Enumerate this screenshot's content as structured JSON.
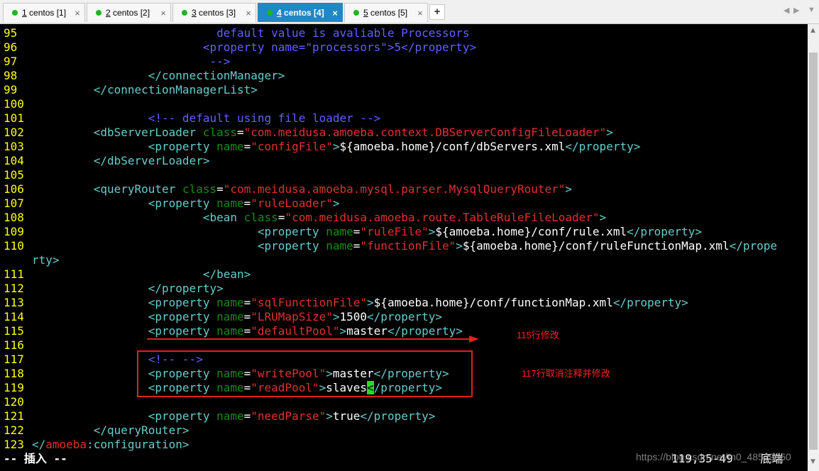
{
  "tabs": [
    {
      "num": "1",
      "label": " centos [1]",
      "active": false
    },
    {
      "num": "2",
      "label": " centos [2]",
      "active": false
    },
    {
      "num": "3",
      "label": " centos [3]",
      "active": false
    },
    {
      "num": "4",
      "label": " centos [4]",
      "active": true
    },
    {
      "num": "5",
      "label": " centos [5]",
      "active": false
    }
  ],
  "tab_close_glyph": "×",
  "tab_add_glyph": "+",
  "nav": {
    "prev": "◀",
    "next": "▶",
    "menu": "▼"
  },
  "editor": {
    "lines": [
      {
        "n": "95",
        "segs": [
          [
            "                           ",
            "white"
          ],
          [
            "default value is avaliable Processors",
            "blue"
          ]
        ]
      },
      {
        "n": "96",
        "segs": [
          [
            "                         ",
            "white"
          ],
          [
            "<property name=\"processors\">5</property>",
            "blue"
          ]
        ]
      },
      {
        "n": "97",
        "segs": [
          [
            "                          ",
            "white"
          ],
          [
            "-->",
            "blue"
          ]
        ]
      },
      {
        "n": "98",
        "segs": [
          [
            "                 ",
            "white"
          ],
          [
            "</connectionManager>",
            "tag"
          ]
        ]
      },
      {
        "n": "99",
        "segs": [
          [
            "         ",
            "white"
          ],
          [
            "</connectionManagerList>",
            "tag"
          ]
        ]
      },
      {
        "n": "100",
        "segs": []
      },
      {
        "n": "101",
        "segs": [
          [
            "                 ",
            "white"
          ],
          [
            "<!-- default using file loader -->",
            "blue"
          ]
        ]
      },
      {
        "n": "102",
        "segs": [
          [
            "         ",
            "white"
          ],
          [
            "<dbServerLoader ",
            "tag"
          ],
          [
            "class",
            "attr"
          ],
          [
            "=",
            "white"
          ],
          [
            "\"com.meidusa.amoeba.context.DBServerConfigFileLoader\"",
            "str"
          ],
          [
            ">",
            "tag"
          ]
        ]
      },
      {
        "n": "103",
        "segs": [
          [
            "                 ",
            "white"
          ],
          [
            "<property ",
            "tag"
          ],
          [
            "name",
            "attr"
          ],
          [
            "=",
            "white"
          ],
          [
            "\"configFile\"",
            "str"
          ],
          [
            ">",
            "tag"
          ],
          [
            "${amoeba.home}/conf/dbServers.xml",
            "white"
          ],
          [
            "</property>",
            "tag"
          ]
        ]
      },
      {
        "n": "104",
        "segs": [
          [
            "         ",
            "white"
          ],
          [
            "</dbServerLoader>",
            "tag"
          ]
        ]
      },
      {
        "n": "105",
        "segs": []
      },
      {
        "n": "106",
        "segs": [
          [
            "         ",
            "white"
          ],
          [
            "<queryRouter ",
            "tag"
          ],
          [
            "class",
            "attr"
          ],
          [
            "=",
            "white"
          ],
          [
            "\"com.meidusa.amoeba.mysql.parser.MysqlQueryRouter\"",
            "str"
          ],
          [
            ">",
            "tag"
          ]
        ]
      },
      {
        "n": "107",
        "segs": [
          [
            "                 ",
            "white"
          ],
          [
            "<property ",
            "tag"
          ],
          [
            "name",
            "attr"
          ],
          [
            "=",
            "white"
          ],
          [
            "\"ruleLoader\"",
            "str"
          ],
          [
            ">",
            "tag"
          ]
        ]
      },
      {
        "n": "108",
        "segs": [
          [
            "                         ",
            "white"
          ],
          [
            "<bean ",
            "tag"
          ],
          [
            "class",
            "attr"
          ],
          [
            "=",
            "white"
          ],
          [
            "\"com.meidusa.amoeba.route.TableRuleFileLoader\"",
            "str"
          ],
          [
            ">",
            "tag"
          ]
        ]
      },
      {
        "n": "109",
        "segs": [
          [
            "                                 ",
            "white"
          ],
          [
            "<property ",
            "tag"
          ],
          [
            "name",
            "attr"
          ],
          [
            "=",
            "white"
          ],
          [
            "\"ruleFile\"",
            "str"
          ],
          [
            ">",
            "tag"
          ],
          [
            "${amoeba.home}/conf/rule.xml",
            "white"
          ],
          [
            "</property>",
            "tag"
          ]
        ]
      },
      {
        "n": "110",
        "segs": [
          [
            "                                 ",
            "white"
          ],
          [
            "<property ",
            "tag"
          ],
          [
            "name",
            "attr"
          ],
          [
            "=",
            "white"
          ],
          [
            "\"functionFile\"",
            "str"
          ],
          [
            ">",
            "tag"
          ],
          [
            "${amoeba.home}/conf/ruleFunctionMap.xml",
            "white"
          ],
          [
            "</prope",
            "tag"
          ]
        ]
      },
      {
        "n": "",
        "segs": [
          [
            "rty>",
            "tag"
          ]
        ]
      },
      {
        "n": "111",
        "segs": [
          [
            "                         ",
            "white"
          ],
          [
            "</bean>",
            "tag"
          ]
        ]
      },
      {
        "n": "112",
        "segs": [
          [
            "                 ",
            "white"
          ],
          [
            "</property>",
            "tag"
          ]
        ]
      },
      {
        "n": "113",
        "segs": [
          [
            "                 ",
            "white"
          ],
          [
            "<property ",
            "tag"
          ],
          [
            "name",
            "attr"
          ],
          [
            "=",
            "white"
          ],
          [
            "\"sqlFunctionFile\"",
            "str"
          ],
          [
            ">",
            "tag"
          ],
          [
            "${amoeba.home}/conf/functionMap.xml",
            "white"
          ],
          [
            "</property>",
            "tag"
          ]
        ]
      },
      {
        "n": "114",
        "segs": [
          [
            "                 ",
            "white"
          ],
          [
            "<property ",
            "tag"
          ],
          [
            "name",
            "attr"
          ],
          [
            "=",
            "white"
          ],
          [
            "\"LRUMapSize\"",
            "str"
          ],
          [
            ">",
            "tag"
          ],
          [
            "1500",
            "white"
          ],
          [
            "</property>",
            "tag"
          ]
        ]
      },
      {
        "n": "115",
        "segs": [
          [
            "                 ",
            "white"
          ],
          [
            "<property ",
            "tag"
          ],
          [
            "name",
            "attr"
          ],
          [
            "=",
            "white"
          ],
          [
            "\"defaultPool\"",
            "str"
          ],
          [
            ">",
            "tag"
          ],
          [
            "master",
            "white"
          ],
          [
            "</property>",
            "tag"
          ]
        ]
      },
      {
        "n": "116",
        "segs": []
      },
      {
        "n": "117",
        "segs": [
          [
            "                 ",
            "white"
          ],
          [
            "<!-- -->",
            "blue"
          ]
        ]
      },
      {
        "n": "118",
        "segs": [
          [
            "                 ",
            "white"
          ],
          [
            "<property ",
            "tag"
          ],
          [
            "name",
            "attr"
          ],
          [
            "=",
            "white"
          ],
          [
            "\"writePool\"",
            "str"
          ],
          [
            ">",
            "tag"
          ],
          [
            "master",
            "white"
          ],
          [
            "</property>",
            "tag"
          ]
        ]
      },
      {
        "n": "119",
        "segs": [
          [
            "                 ",
            "white"
          ],
          [
            "<property ",
            "tag"
          ],
          [
            "name",
            "attr"
          ],
          [
            "=",
            "white"
          ],
          [
            "\"readPool\"",
            "str"
          ],
          [
            ">",
            "tag"
          ],
          [
            "slaves",
            "white"
          ],
          [
            "<",
            "cursor"
          ],
          [
            "/property>",
            "tag"
          ]
        ]
      },
      {
        "n": "120",
        "segs": []
      },
      {
        "n": "121",
        "segs": [
          [
            "                 ",
            "white"
          ],
          [
            "<property ",
            "tag"
          ],
          [
            "name",
            "attr"
          ],
          [
            "=",
            "white"
          ],
          [
            "\"needParse\"",
            "str"
          ],
          [
            ">",
            "tag"
          ],
          [
            "true",
            "white"
          ],
          [
            "</property>",
            "tag"
          ]
        ]
      },
      {
        "n": "122",
        "segs": [
          [
            "         ",
            "white"
          ],
          [
            "</queryRouter>",
            "tag"
          ]
        ]
      },
      {
        "n": "123",
        "segs": [
          [
            "</",
            "tag"
          ],
          [
            "amoeba",
            "str"
          ],
          [
            ":configuration>",
            "tag"
          ]
        ]
      }
    ]
  },
  "status": {
    "mode": "-- 插入 --",
    "position": "119,35-49",
    "where": "底端"
  },
  "annotations": {
    "line115": "115行修改",
    "line117": "117行取消注释并修改"
  },
  "watermark": "https://blog.csdn.net/m0_48529960",
  "colors": {
    "tag": "#66cccc",
    "attr": "#1a8a1a",
    "str": "#e03030",
    "comment": "#6060ff",
    "linenum": "#ffff00",
    "annotation": "#ff2020",
    "tab_active": "#1e88c8"
  }
}
